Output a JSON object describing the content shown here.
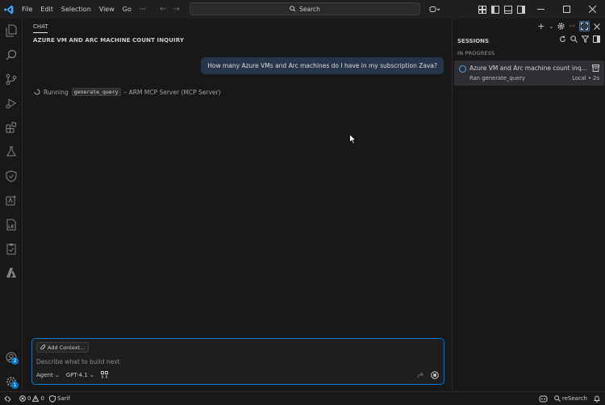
{
  "titlebar": {
    "menus": [
      "File",
      "Edit",
      "Selection",
      "View",
      "Go",
      "···"
    ],
    "search_label": "Search"
  },
  "activity_bar": {
    "account_badge": "2",
    "settings_badge": "1"
  },
  "chat": {
    "tab_label": "CHAT",
    "title": "AZURE VM AND ARC MACHINE COUNT INQUIRY",
    "user_message": "How many Azure VMs and Arc machines do I have in my subscription Zava?",
    "running_prefix": "Running",
    "running_tool": "generate_query",
    "running_suffix": "– ARM MCP Server (MCP Server)",
    "input": {
      "add_context": "Add Context...",
      "placeholder": "Describe what to build next",
      "mode": "Agent",
      "model": "GPT-4.1"
    }
  },
  "sessions": {
    "title": "SESSIONS",
    "group": "IN PROGRESS",
    "items": [
      {
        "name": "Azure VM and Arc machine count inqu...",
        "subtitle": "Ran generate_query",
        "meta": "Local • 2s"
      }
    ]
  },
  "statusbar": {
    "errors": "0",
    "warnings": "0",
    "user": "Sarif",
    "research": "reSearch"
  },
  "colors": {
    "accent": "#0078d4",
    "background": "#181818",
    "user_bubble": "#26354a"
  }
}
